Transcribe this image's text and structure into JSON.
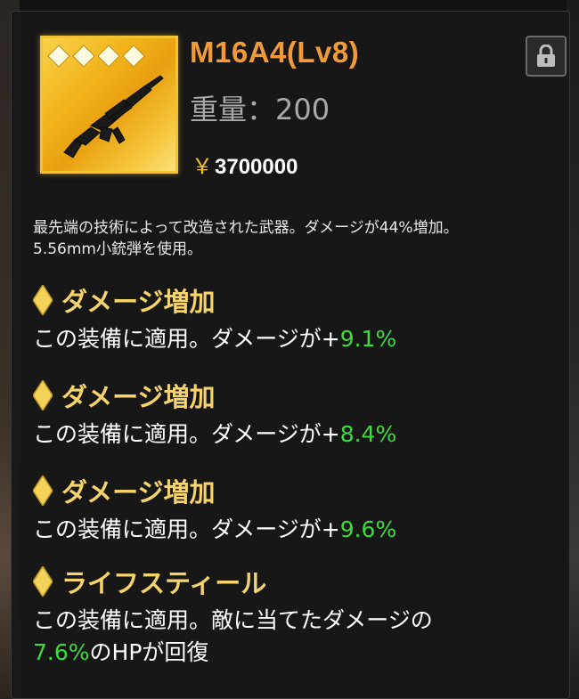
{
  "item": {
    "name": "M16A4(Lv8)",
    "weight": "重量：200",
    "price_symbol": "￥",
    "price": "3700000",
    "stars": 4,
    "icon": "assault-rifle-icon"
  },
  "description": {
    "line1": "最先端の技術によって改造された武器。ダメージが44%増加。",
    "line2": "5.56mm小銃弾を使用。"
  },
  "effects": [
    {
      "title": "ダメージ増加",
      "prefix": "この装備に適用。ダメージが+",
      "value": "9.1%"
    },
    {
      "title": "ダメージ増加",
      "prefix": "この装備に適用。ダメージが+",
      "value": "8.4%"
    },
    {
      "title": "ダメージ増加",
      "prefix": "この装備に適用。ダメージが+",
      "value": "9.6%"
    },
    {
      "title": "ライフスティール",
      "line1": "この装備に適用。敵に当てたダメージの",
      "value": "7.6%",
      "suffix": "のHPが回復"
    }
  ],
  "colors": {
    "name": "#f29a3a",
    "effect_title": "#f6d36b",
    "value_green": "#3ddc3d",
    "icon_border": "#f2c230"
  },
  "lock_icon": "lock-icon"
}
